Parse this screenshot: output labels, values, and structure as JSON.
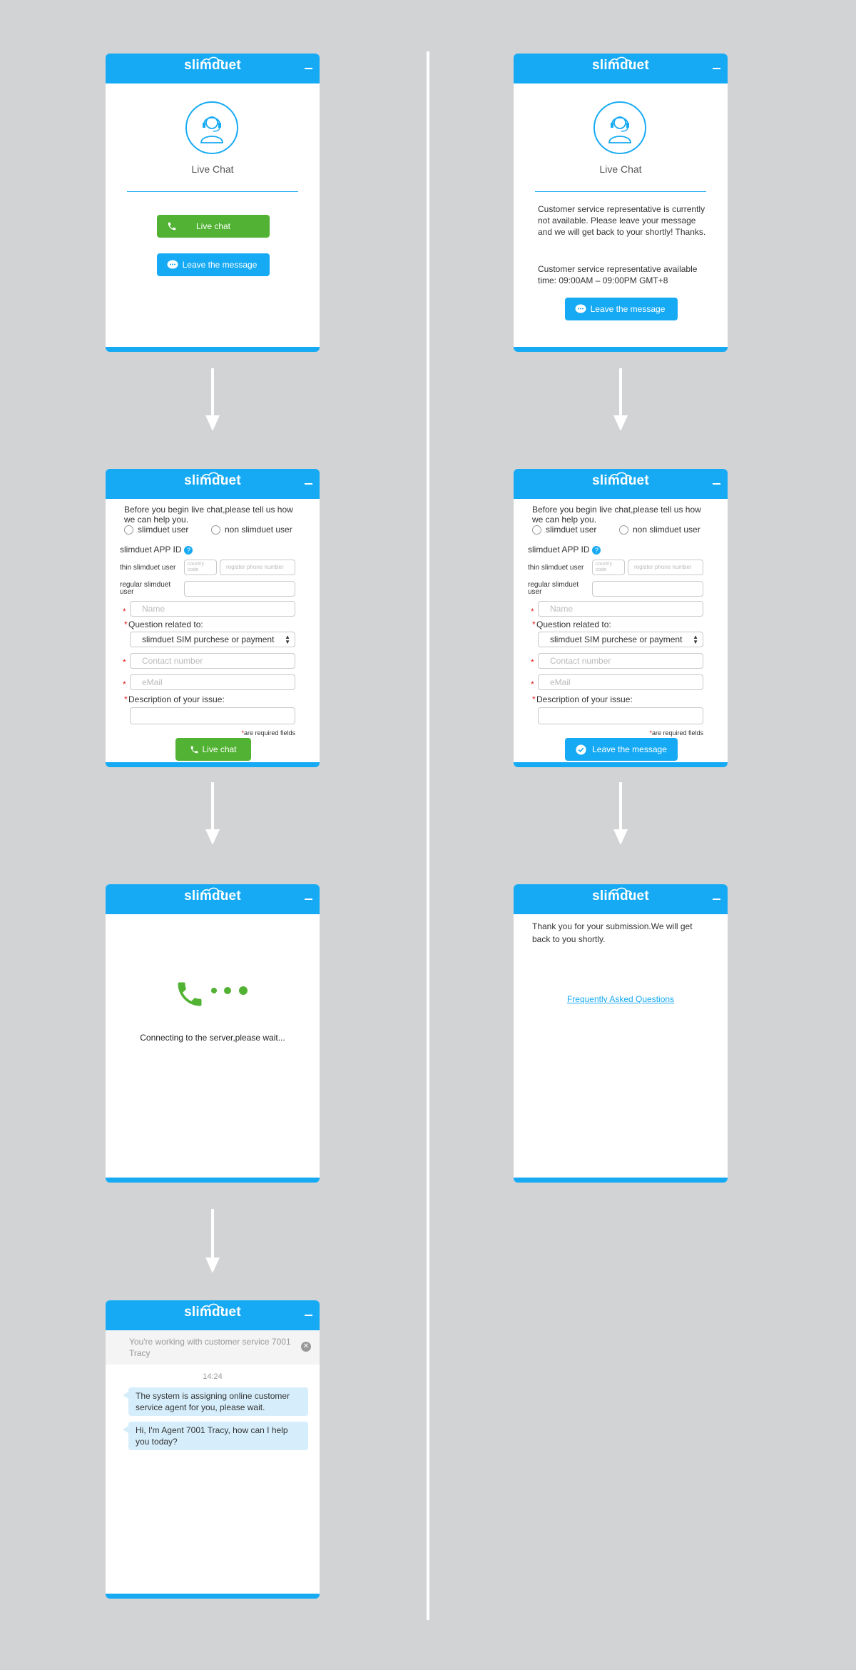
{
  "brand": {
    "logo_text": "slimduet",
    "accent_color": "#17aaf4",
    "green_color": "#52b233"
  },
  "welcome": {
    "title": "Live Chat",
    "live_chat_button": "Live chat",
    "leave_message_button": "Leave the message"
  },
  "offline": {
    "title": "Live Chat",
    "message_1": "Customer service representative is currently not available. Please leave your message and we will get back to your shortly! Thanks.",
    "message_2": "Customer service representative available time: 09:00AM – 09:00PM GMT+8",
    "leave_message_button": "Leave the message"
  },
  "form": {
    "intro": "Before you begin live chat,please tell us how we can help you.",
    "radio_slimduet": "slimduet user",
    "radio_non_slimduet": "non slimduet user",
    "app_id_label": "slimduet APP ID",
    "help_icon": "?",
    "thin_user_label": "thin slimduet user",
    "country_code_placeholder": "country code",
    "register_phone_placeholder": "register phone number",
    "regular_user_label": "regular slimduet user",
    "name_placeholder": "Name",
    "question_label": "Question related to:",
    "question_selected": "slimduet SIM purchese or payment",
    "contact_placeholder": "Contact number",
    "email_placeholder": "eMail",
    "description_label": "Description of your issue:",
    "required_star": "*",
    "required_note": "are required fields",
    "submit_live_chat": "Live chat",
    "submit_leave_message": "Leave the message"
  },
  "connecting": {
    "text": "Connecting to the server,please wait..."
  },
  "thanks": {
    "text": "Thank you for your submission.We will get back to you shortly.",
    "faq_link": "Frequently Asked Questions"
  },
  "chat": {
    "banner": "You're working with customer service 7001 Tracy",
    "time": "14:24",
    "messages": [
      "The system is assigning online customer service agent for you, please wait.",
      "Hi, I'm Agent 7001 Tracy, how can I help you today?"
    ]
  }
}
